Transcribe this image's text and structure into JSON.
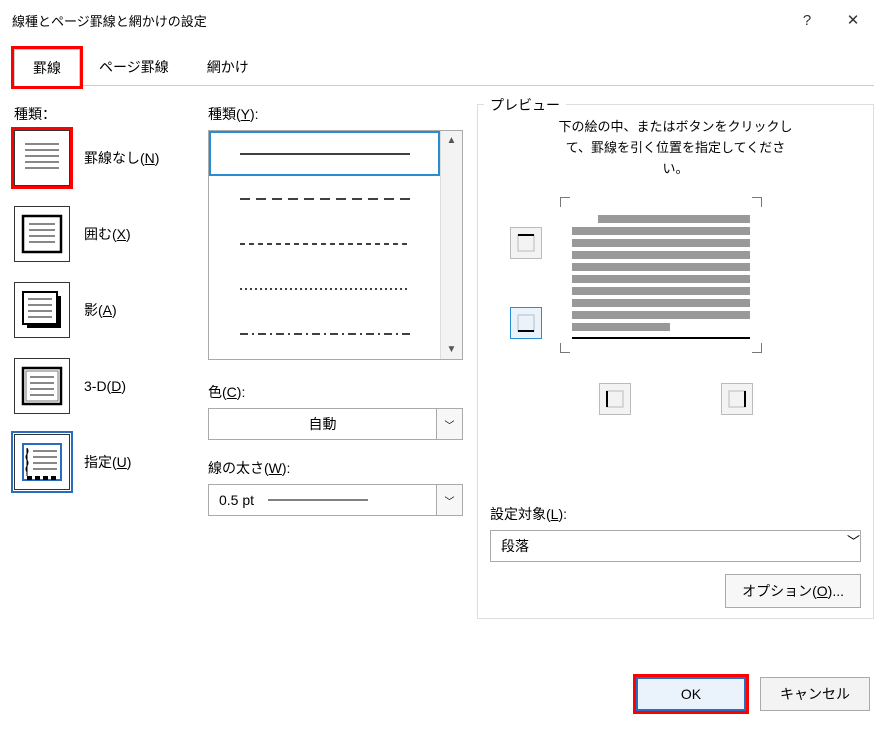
{
  "title": "線種とページ罫線と網かけの設定",
  "titlebar": {
    "help": "?",
    "close": "✕"
  },
  "tabs": {
    "borders": "罫線",
    "page_borders": "ページ罫線",
    "shading": "網かけ"
  },
  "left": {
    "section": "種類：",
    "items": [
      {
        "label_pre": "罫線なし(",
        "key": "N",
        "label_post": ")"
      },
      {
        "label_pre": "囲む(",
        "key": "X",
        "label_post": ")"
      },
      {
        "label_pre": "影(",
        "key": "A",
        "label_post": ")"
      },
      {
        "label_pre": "3-D(",
        "key": "D",
        "label_post": ")"
      },
      {
        "label_pre": "指定(",
        "key": "U",
        "label_post": ")"
      }
    ]
  },
  "style": {
    "section_pre": "種類(",
    "key": "Y",
    "section_post": "):"
  },
  "color": {
    "label_pre": "色(",
    "key": "C",
    "label_post": "):",
    "value": "自動"
  },
  "width": {
    "label_pre": "線の太さ(",
    "key": "W",
    "label_post": "):",
    "value": "0.5 pt"
  },
  "preview": {
    "legend": "プレビュー",
    "hint1": "下の絵の中、またはボタンをクリックし",
    "hint2": "て、罫線を引く位置を指定してくださ",
    "hint3": "い。"
  },
  "apply": {
    "label_pre": "設定対象(",
    "key": "L",
    "label_post": "):",
    "value": "段落"
  },
  "options": {
    "label_pre": "オプション(",
    "key": "O",
    "label_post": ")..."
  },
  "buttons": {
    "ok": "OK",
    "cancel": "キャンセル"
  }
}
